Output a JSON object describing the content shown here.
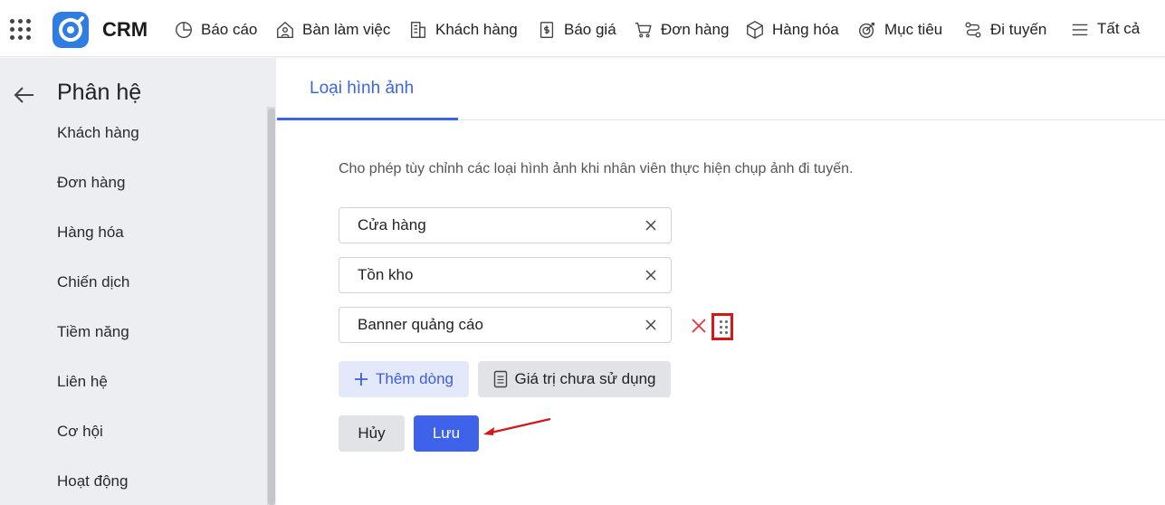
{
  "header": {
    "brand": "CRM",
    "nav": [
      {
        "label": "Báo cáo",
        "icon": "pie-chart-icon"
      },
      {
        "label": "Bàn làm việc",
        "icon": "home-user-icon"
      },
      {
        "label": "Khách hàng",
        "icon": "building-icon"
      },
      {
        "label": "Báo giá",
        "icon": "quote-doc-icon"
      },
      {
        "label": "Đơn hàng",
        "icon": "cart-icon"
      },
      {
        "label": "Hàng hóa",
        "icon": "box-icon"
      },
      {
        "label": "Mục tiêu",
        "icon": "target-icon"
      },
      {
        "label": "Đi tuyến",
        "icon": "route-icon"
      },
      {
        "label": "Tất cả",
        "icon": "menu-icon"
      }
    ]
  },
  "sidebar": {
    "title": "Phân hệ",
    "items": [
      "Khách hàng",
      "Đơn hàng",
      "Hàng hóa",
      "Chiến dịch",
      "Tiềm năng",
      "Liên hệ",
      "Cơ hội",
      "Hoạt động"
    ]
  },
  "main": {
    "tab": "Loại hình ảnh",
    "description": "Cho phép tùy chỉnh các loại hình ảnh khi nhân viên thực hiện chụp ảnh đi tuyến.",
    "fields": [
      "Cửa hàng",
      "Tồn kho",
      "Banner quảng cáo"
    ],
    "add_row_label": "Thêm dòng",
    "unused_label": "Giá trị chưa sử dụng",
    "cancel_label": "Hủy",
    "save_label": "Lưu"
  },
  "colors": {
    "accent": "#3b64e6",
    "danger": "#d31818",
    "logo": "#2f7de1"
  }
}
